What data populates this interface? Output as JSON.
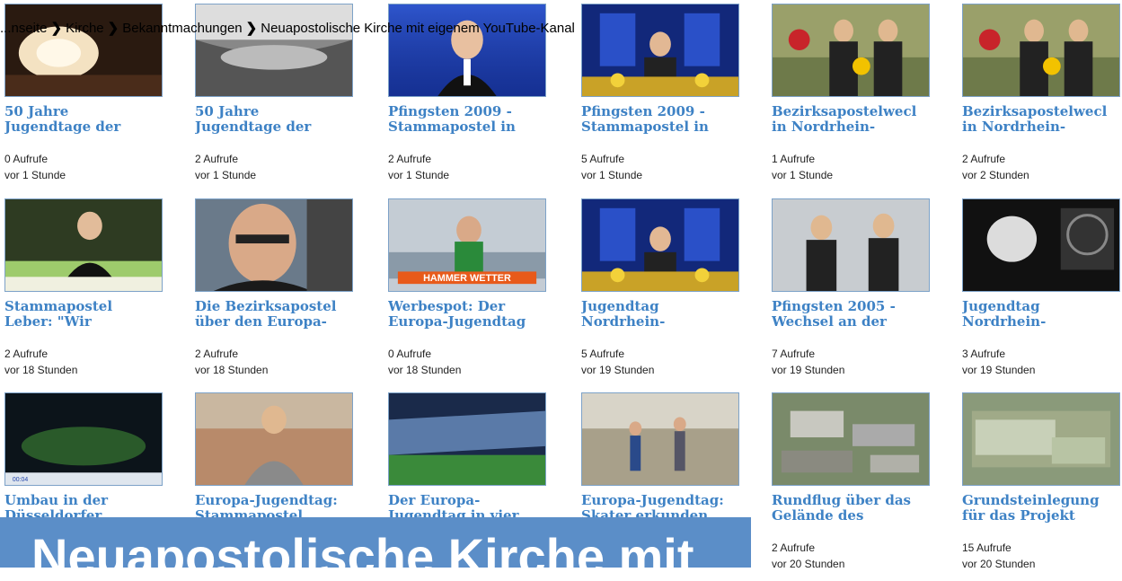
{
  "breadcrumb": {
    "items": [
      "...nseite",
      "Kirche",
      "Bekanntmachungen",
      "Neuapostolische Kirche mit eigenem YouTube-Kanal"
    ],
    "separator": "❯"
  },
  "videos": [
    {
      "title_line1": "50 Jahre",
      "title_line2": "Jugendtage der",
      "views": "0 Aufrufe",
      "age": "vor 1 Stunde",
      "thumb": "concert-hall"
    },
    {
      "title_line1": "50 Jahre",
      "title_line2": "Jugendtage der",
      "views": "2 Aufrufe",
      "age": "vor 1 Stunde",
      "thumb": "stadium-bw"
    },
    {
      "title_line1": "Pfingsten 2009 -",
      "title_line2": "Stammapostel in",
      "views": "2 Aufrufe",
      "age": "vor 1 Stunde",
      "thumb": "speaker-blue"
    },
    {
      "title_line1": "Pfingsten 2009 -",
      "title_line2": "Stammapostel in",
      "views": "5 Aufrufe",
      "age": "vor 1 Stunde",
      "thumb": "altar-blue"
    },
    {
      "title_line1": "Bezirksapostelwecl",
      "title_line2": "in Nordrhein-",
      "views": "1 Aufrufe",
      "age": "vor 1 Stunde",
      "thumb": "flowers-men"
    },
    {
      "title_line1": "Bezirksapostelwecl",
      "title_line2": "in Nordrhein-",
      "views": "2 Aufrufe",
      "age": "vor 2 Stunden",
      "thumb": "flowers-men"
    },
    {
      "title_line1": "Stammapostel",
      "title_line2": "Leber: \"Wir",
      "views": "2 Aufrufe",
      "age": "vor 18 Stunden",
      "thumb": "speaker-green"
    },
    {
      "title_line1": "Die Bezirksapostel",
      "title_line2": "über den Europa-",
      "views": "2 Aufrufe",
      "age": "vor 18 Stunden",
      "thumb": "portrait"
    },
    {
      "title_line1": "Werbespot: Der",
      "title_line2": "Europa-Jugendtag",
      "views": "0 Aufrufe",
      "age": "vor 18 Stunden",
      "thumb": "hammer-wetter",
      "overlay": "HAMMER WETTER"
    },
    {
      "title_line1": "Jugendtag",
      "title_line2": "Nordrhein-",
      "views": "5 Aufrufe",
      "age": "vor 19 Stunden",
      "thumb": "altar-blue"
    },
    {
      "title_line1": "Pfingsten 2005 -",
      "title_line2": "Wechsel an der",
      "views": "7 Aufrufe",
      "age": "vor 19 Stunden",
      "thumb": "two-men"
    },
    {
      "title_line1": "Jugendtag",
      "title_line2": "Nordrhein-",
      "views": "3 Aufrufe",
      "age": "vor 19 Stunden",
      "thumb": "dark-stage"
    },
    {
      "title_line1": "Umbau in der",
      "title_line2": "Düsseldorfer",
      "views": "",
      "age": "",
      "thumb": "stadium-night"
    },
    {
      "title_line1": "Europa-Jugendtag:",
      "title_line2": "Stammapostel",
      "views": "",
      "age": "",
      "thumb": "man-stadium"
    },
    {
      "title_line1": "Der Europa-",
      "title_line2": "Jugendtag in vier",
      "views": "",
      "age": "",
      "thumb": "stadium-green"
    },
    {
      "title_line1": "Europa-Jugendtag:",
      "title_line2": "Skater erkunden",
      "views": "",
      "age": "",
      "thumb": "skaters"
    },
    {
      "title_line1": "Rundflug über das",
      "title_line2": "Gelände des",
      "views": "2 Aufrufe",
      "age": "vor 20 Stunden",
      "thumb": "aerial"
    },
    {
      "title_line1": "Grundsteinlegung",
      "title_line2": "für das Projekt",
      "views": "15 Aufrufe",
      "age": "vor 20 Stunden",
      "thumb": "plan"
    }
  ],
  "banner": {
    "title": "Neuapostolische Kirche mit"
  },
  "colors": {
    "link": "#3e82c5",
    "banner": "#5b8ec8",
    "thumb_border": "#7da2c8"
  }
}
